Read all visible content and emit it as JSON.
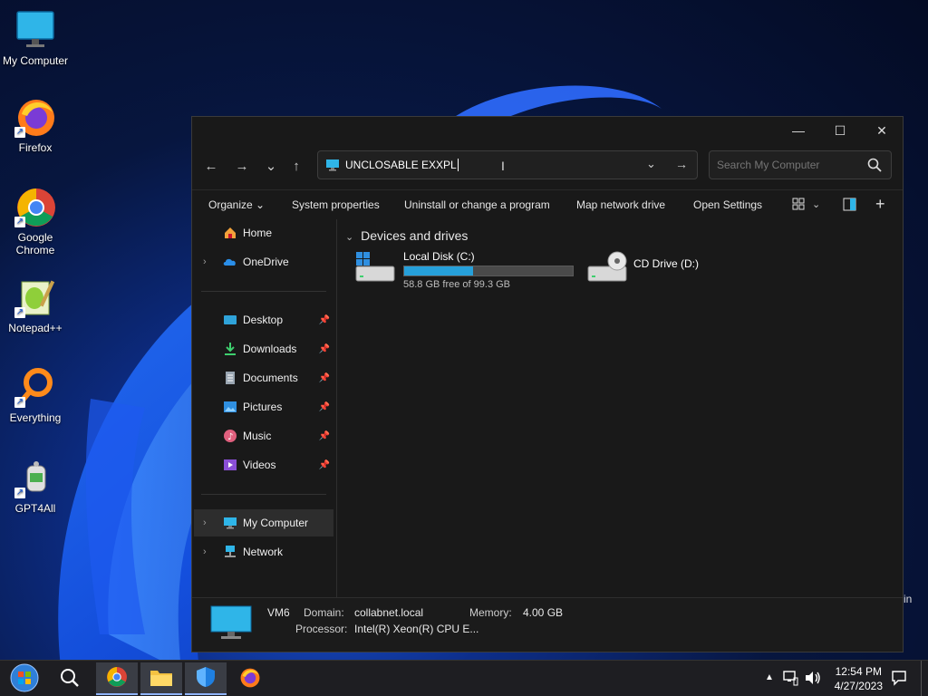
{
  "desktop": {
    "icons": [
      {
        "label": "My Computer",
        "icon": "monitor-icon"
      },
      {
        "label": "Firefox",
        "icon": "firefox-icon"
      },
      {
        "label": "Google Chrome",
        "icon": "chrome-icon"
      },
      {
        "label": "Notepad++",
        "icon": "notepad-plus-icon"
      },
      {
        "label": "Everything",
        "icon": "everything-search-icon"
      },
      {
        "label": "GPT4All",
        "icon": "gpt4all-icon"
      }
    ],
    "peek_text": "in"
  },
  "window": {
    "controls": {
      "minimize": "—",
      "maximize": "☐",
      "close": "✕"
    },
    "nav": {
      "back": "←",
      "forward": "→",
      "recent": "⌄",
      "up": "↑"
    },
    "address": {
      "value": "UNCLOSABLE EXXPL",
      "dropdown": "⌄",
      "go": "→"
    },
    "search": {
      "placeholder": "Search My Computer"
    },
    "toolbar": {
      "organize": "Organize ⌄",
      "system_properties": "System properties",
      "uninstall": "Uninstall or change a program",
      "map_drive": "Map network drive",
      "open_settings": "Open Settings",
      "add": "+"
    },
    "sidebar": {
      "home": "Home",
      "onedrive": "OneDrive",
      "quick": [
        {
          "label": "Desktop"
        },
        {
          "label": "Downloads"
        },
        {
          "label": "Documents"
        },
        {
          "label": "Pictures"
        },
        {
          "label": "Music"
        },
        {
          "label": "Videos"
        }
      ],
      "my_computer": "My Computer",
      "network": "Network"
    },
    "content": {
      "group": "Devices and drives",
      "drives": [
        {
          "name": "Local Disk (C:)",
          "free_text": "58.8 GB free of 99.3 GB",
          "used_fraction": 0.41
        },
        {
          "name": "CD Drive (D:)"
        }
      ]
    },
    "details": {
      "name": "VM6",
      "domain_label": "Domain:",
      "domain_value": "collabnet.local",
      "memory_label": "Memory:",
      "memory_value": "4.00 GB",
      "processor_label": "Processor:",
      "processor_value": "Intel(R) Xeon(R) CPU E..."
    }
  },
  "taskbar": {
    "time": "12:54 PM",
    "date": "4/27/2023",
    "accent": "#26a0da"
  }
}
